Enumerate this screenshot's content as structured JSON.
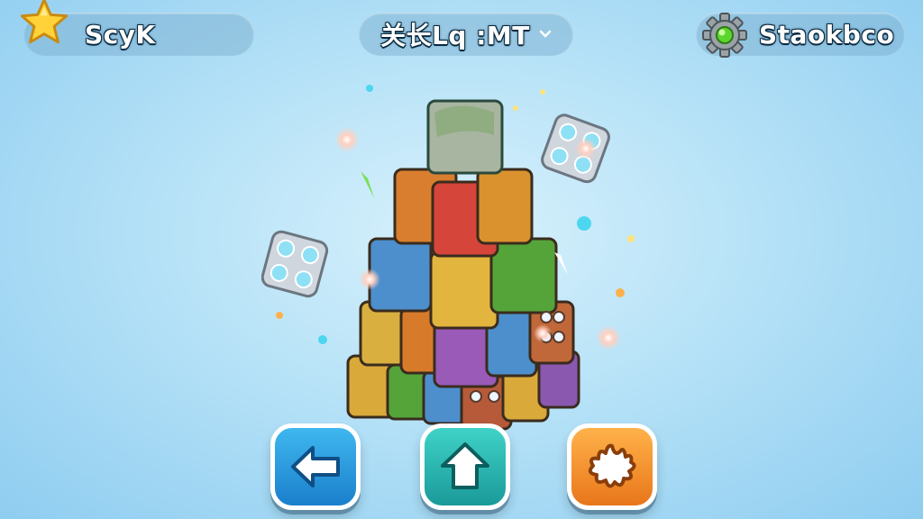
{
  "player": {
    "name": "ScyK",
    "icon": "star-icon"
  },
  "level": {
    "title": "关长Lq :MT",
    "icon": "chevron-down-icon"
  },
  "settings": {
    "label": "Staokbco",
    "icon": "gear-icon"
  },
  "buttons": {
    "back": {
      "icon": "arrow-left-icon",
      "color": "#2a9ee0"
    },
    "home": {
      "icon": "home-arrow-icon",
      "color": "#2bb8b0"
    },
    "splash": {
      "icon": "splash-icon",
      "color": "#f5922e"
    }
  }
}
